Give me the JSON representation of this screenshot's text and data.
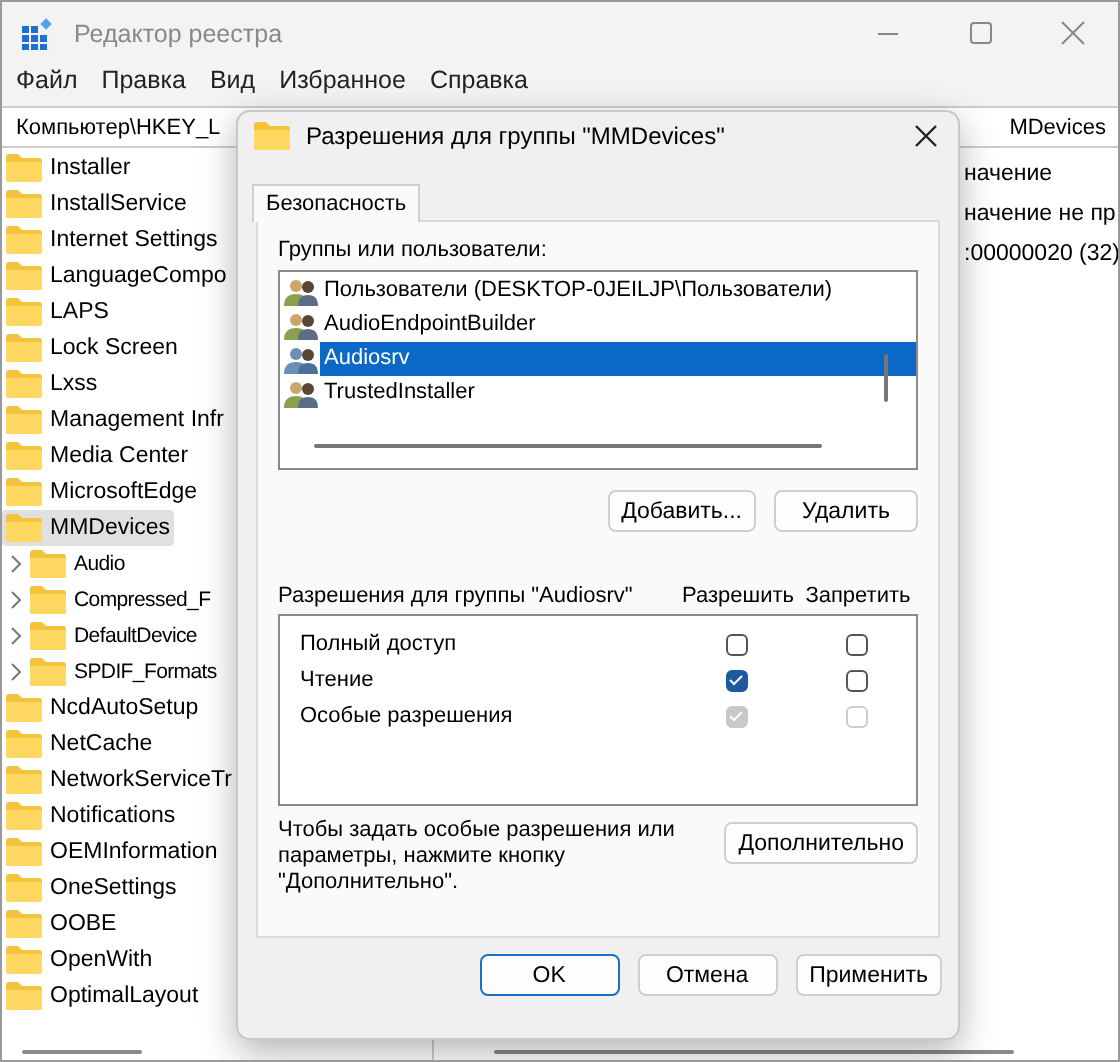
{
  "window": {
    "title": "Редактор реестра"
  },
  "menu": [
    "Файл",
    "Правка",
    "Вид",
    "Избранное",
    "Справка"
  ],
  "address": {
    "left": "Компьютер\\HKEY_L",
    "right": "MDevices"
  },
  "tree": [
    {
      "label": "Installer",
      "selected": false
    },
    {
      "label": "InstallService",
      "selected": false
    },
    {
      "label": "Internet Settings",
      "selected": false
    },
    {
      "label": "LanguageCompo",
      "selected": false
    },
    {
      "label": "LAPS",
      "selected": false
    },
    {
      "label": "Lock Screen",
      "selected": false
    },
    {
      "label": "Lxss",
      "selected": false
    },
    {
      "label": "Management Infr",
      "selected": false
    },
    {
      "label": "Media Center",
      "selected": false
    },
    {
      "label": "MicrosoftEdge",
      "selected": false
    },
    {
      "label": "MMDevices",
      "selected": true,
      "children": [
        {
          "label": "Audio",
          "selected": false,
          "expanded": false
        },
        {
          "label": "Compressed_F",
          "selected": false,
          "expanded": false
        },
        {
          "label": "DefaultDevice",
          "selected": false,
          "expanded": false
        },
        {
          "label": "SPDIF_Formats",
          "selected": false,
          "expanded": false
        }
      ]
    },
    {
      "label": "NcdAutoSetup",
      "selected": false
    },
    {
      "label": "NetCache",
      "selected": false
    },
    {
      "label": "NetworkServiceTr",
      "selected": false
    },
    {
      "label": "Notifications",
      "selected": false
    },
    {
      "label": "OEMInformation",
      "selected": false
    },
    {
      "label": "OneSettings",
      "selected": false
    },
    {
      "label": "OOBE",
      "selected": false
    },
    {
      "label": "OpenWith",
      "selected": false
    },
    {
      "label": "OptimalLayout",
      "selected": false
    }
  ],
  "values_pane": {
    "column_1": [
      "начение",
      "начение не пр",
      ":00000020 (32)"
    ]
  },
  "dialog": {
    "title": "Разрешения для группы \"MMDevices\"",
    "tabs": [
      {
        "label": "Безопасность",
        "selected": true
      }
    ],
    "groups_label": "Группы или пользователи:",
    "users": [
      {
        "name": "Пользователи (DESKTOP-0JEILJP\\Пользователи)",
        "selected": false
      },
      {
        "name": "AudioEndpointBuilder",
        "selected": false
      },
      {
        "name": "Audiosrv",
        "selected": true
      },
      {
        "name": "TrustedInstaller",
        "selected": false
      }
    ],
    "add_button": "Добавить...",
    "remove_button": "Удалить",
    "permissions_label": "Разрешения для группы \"Audiosrv\"",
    "allow_header": "Разрешить",
    "deny_header": "Запретить",
    "permissions": [
      {
        "name": "Полный доступ",
        "allow": {
          "checked": false,
          "disabled": false
        },
        "deny": {
          "checked": false,
          "disabled": false
        }
      },
      {
        "name": "Чтение",
        "allow": {
          "checked": true,
          "disabled": false
        },
        "deny": {
          "checked": false,
          "disabled": false
        }
      },
      {
        "name": "Особые разрешения",
        "allow": {
          "checked": true,
          "disabled": true
        },
        "deny": {
          "checked": false,
          "disabled": true
        }
      }
    ],
    "hint": "Чтобы задать особые разрешения или параметры, нажмите кнопку \"Дополнительно\".",
    "advanced_button": "Дополнительно",
    "buttons": [
      {
        "label": "OK",
        "default": true
      },
      {
        "label": "Отмена",
        "default": false
      },
      {
        "label": "Применить",
        "default": false
      }
    ]
  }
}
